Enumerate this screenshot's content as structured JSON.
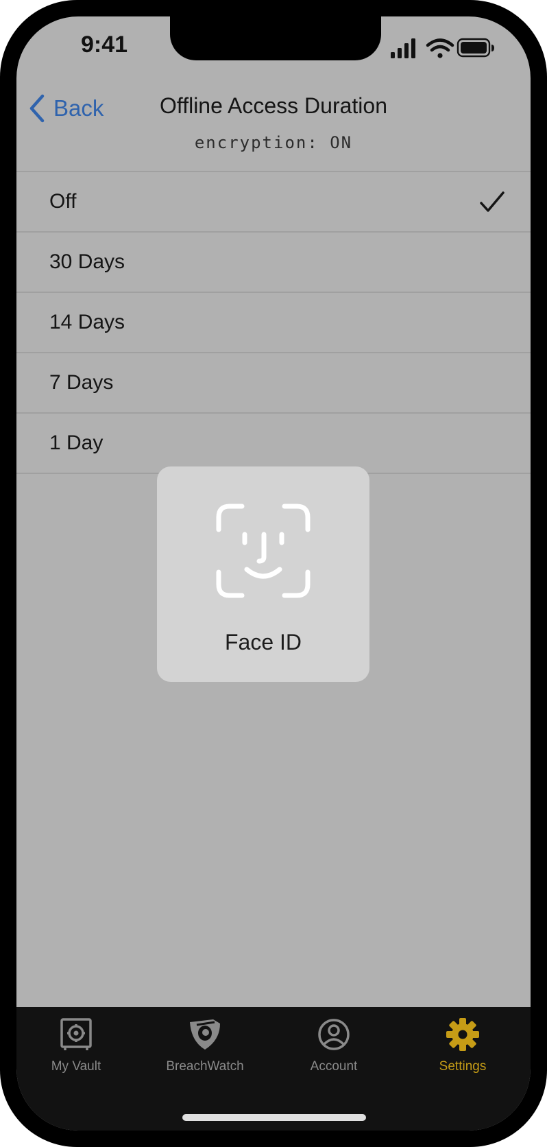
{
  "status_bar": {
    "time": "9:41"
  },
  "header": {
    "back_label": "Back",
    "title": "Offline Access Duration",
    "subtitle": "encryption: ON"
  },
  "options": [
    {
      "label": "Off",
      "selected": true
    },
    {
      "label": "30 Days",
      "selected": false
    },
    {
      "label": "14 Days",
      "selected": false
    },
    {
      "label": "7 Days",
      "selected": false
    },
    {
      "label": "1 Day",
      "selected": false
    }
  ],
  "face_id": {
    "label": "Face ID"
  },
  "tabs": [
    {
      "label": "My Vault",
      "icon": "vault-icon",
      "active": false
    },
    {
      "label": "BreachWatch",
      "icon": "breachwatch-shield-icon",
      "active": false
    },
    {
      "label": "Account",
      "icon": "account-person-icon",
      "active": false
    },
    {
      "label": "Settings",
      "icon": "gear-icon",
      "active": true
    }
  ],
  "colors": {
    "accent_link": "#2f63ad",
    "active_tab": "#c69c16",
    "background_dimmed": "#b1b1b1",
    "tabbar_bg": "#121212"
  }
}
